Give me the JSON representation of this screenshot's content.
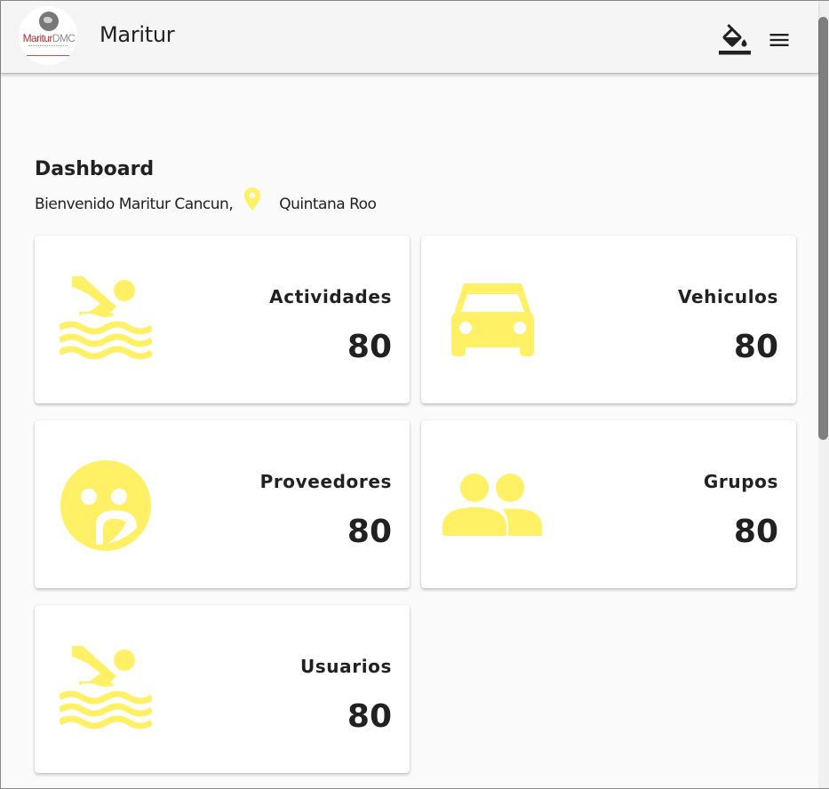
{
  "app": {
    "title": "Maritur",
    "logo": {
      "brand_red": "Maritur",
      "brand_gray": "DMC",
      "brand_color": "#b0302b"
    }
  },
  "toolbar": {
    "theme_icon": "format-color-fill-icon",
    "menu_icon": "menu-icon"
  },
  "dashboard": {
    "title": "Dashboard",
    "welcome_text": "Bienvenido Maritur Cancun,",
    "location_icon": "location-pin-icon",
    "location": "Quintana Roo",
    "accent_color": "#fff066",
    "cards": [
      {
        "label": "Actividades",
        "value": "80",
        "icon": "pool-swimmer-icon"
      },
      {
        "label": "Vehiculos",
        "value": "80",
        "icon": "car-icon"
      },
      {
        "label": "Proveedores",
        "value": "80",
        "icon": "supervisor-face-icon"
      },
      {
        "label": "Grupos",
        "value": "80",
        "icon": "people-icon"
      },
      {
        "label": "Usuarios",
        "value": "80",
        "icon": "pool-swimmer-icon"
      }
    ]
  }
}
